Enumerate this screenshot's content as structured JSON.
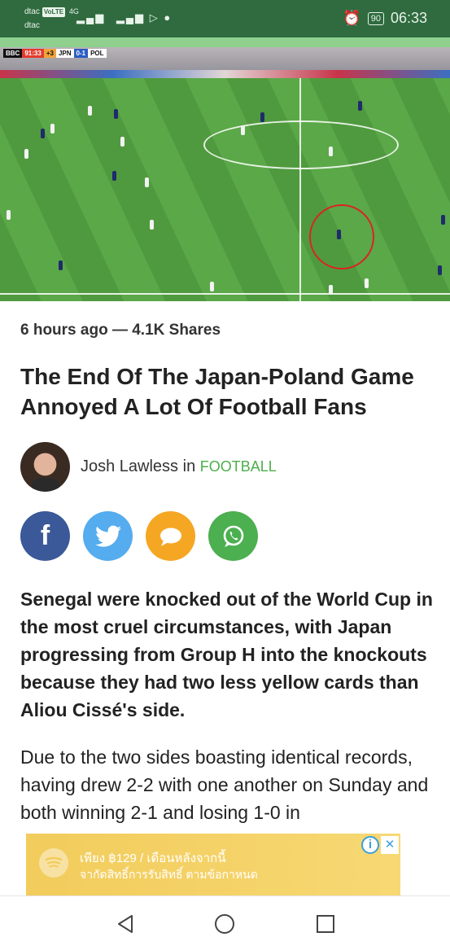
{
  "status_bar": {
    "carrier_top": "dtac",
    "volte": "VoLTE",
    "network": "4G",
    "carrier_bottom": "dtac",
    "battery": "90",
    "time": "06:33"
  },
  "hero": {
    "scorebug": {
      "broadcaster": "BBC",
      "clock": "91:33",
      "added": "+3",
      "home": "JPN",
      "score": "0-1",
      "away": "POL"
    }
  },
  "article": {
    "meta": "6 hours ago — 4.1K  Shares",
    "headline": "The End Of The Japan-Poland Game Annoyed A Lot Of Football Fans",
    "author": "Josh Lawless",
    "author_connector": " in ",
    "category": "FOOTBALL",
    "lead": "Senegal were knocked out of the World Cup in the most cruel circumstances, with Japan progressing from Group H into the knockouts because they had two less yellow cards than Aliou Cissé's side.",
    "body": "Due to the two sides boasting identical records, having drew 2-2 with one another on Sunday and both winning 2-1 and losing 1-0 in"
  },
  "share": {
    "icons": [
      "facebook-icon",
      "twitter-icon",
      "message-icon",
      "whatsapp-icon"
    ],
    "facebook_glyph": "f",
    "colors": {
      "facebook": "#3b5998",
      "twitter": "#55acee",
      "message": "#f5a623",
      "whatsapp": "#4caf50"
    }
  },
  "ad": {
    "line1": "เพียง ฿129 / เดือนหลังจากนี้",
    "line2": "จากัดสิทธิ์การรับสิทธิ์ ตามข้อกาหนด",
    "info_glyph": "i",
    "close_glyph": "✕",
    "color": "#f2cc5c"
  },
  "nav": {
    "icons": [
      "back-icon",
      "home-icon",
      "recent-apps-icon"
    ]
  },
  "colors": {
    "status_bar": "#2f6b3f",
    "accent": "#4cae4c"
  }
}
